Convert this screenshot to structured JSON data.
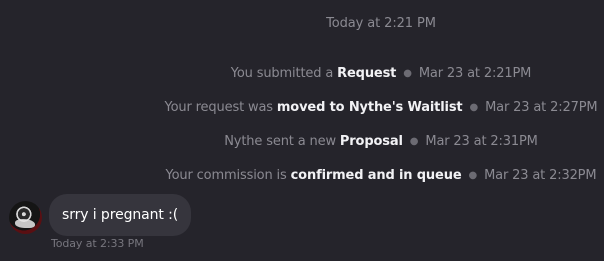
{
  "conversation": {
    "day_stamp": "Today at 2:21 PM",
    "events": [
      {
        "prefix": "You submitted a ",
        "strong": "Request",
        "time": "Mar 23 at 2:21PM"
      },
      {
        "prefix": "Your request was ",
        "strong": "moved to Nythe's Waitlist",
        "time": "Mar 23 at 2:27PM"
      },
      {
        "prefix": "Nythe sent a new ",
        "strong": "Proposal",
        "time": "Mar 23 at 2:31PM"
      },
      {
        "prefix": "Your commission is ",
        "strong": "confirmed and in queue",
        "time": "Mar 23 at 2:32PM"
      }
    ],
    "message": {
      "text": "srry i pregnant :(",
      "timestamp": "Today at 2:33 PM"
    }
  },
  "colors": {
    "background": "#25242b",
    "bubble": "#36353d",
    "muted_text": "#8b8a92",
    "strong_text": "#f2f2f5"
  },
  "icons": {
    "separator": "bullet-dot",
    "avatar": "user-avatar-image"
  }
}
